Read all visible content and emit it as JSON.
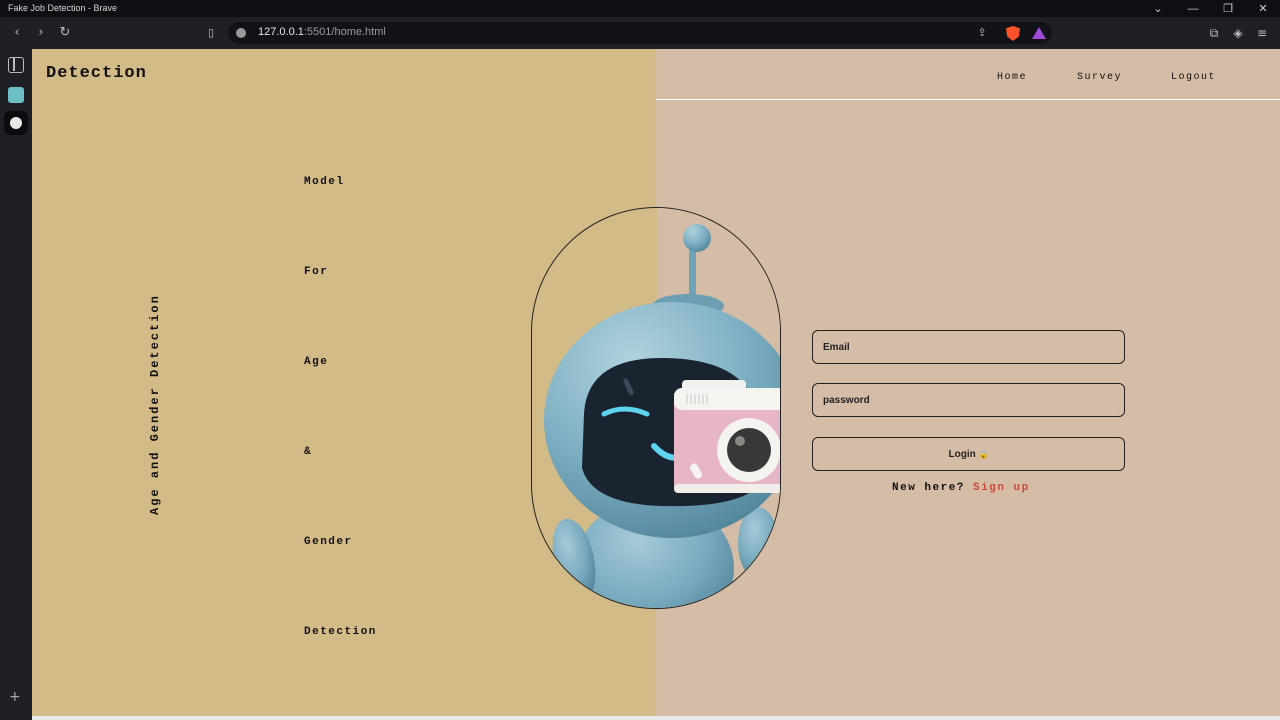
{
  "browser": {
    "window_title": "Fake Job Detection - Brave",
    "url_host": "127.0.0.1",
    "url_rest": ":5501/home.html",
    "minimize": "—",
    "restore": "❐",
    "close": "✕",
    "chevron": "⌄"
  },
  "nav": {
    "brand": "Detection",
    "links": [
      "Home",
      "Survey",
      "Logout"
    ]
  },
  "hero": {
    "vertical_title": "Age and Gender Detection",
    "words": [
      "Model",
      "For",
      "Age",
      "&",
      "Gender",
      "Detection"
    ]
  },
  "form": {
    "email_placeholder": "Email",
    "password_placeholder": "password",
    "login_label": "Login",
    "login_emoji": "🔒",
    "new_here": "New here?",
    "sign_up": "Sign up"
  },
  "colors": {
    "left_panel": "#d3bb88",
    "right_panel": "#d5bca6",
    "robot_body": "#77a9bd",
    "camera": "#e7b6c6",
    "sign_up_link": "#c84b3c"
  }
}
